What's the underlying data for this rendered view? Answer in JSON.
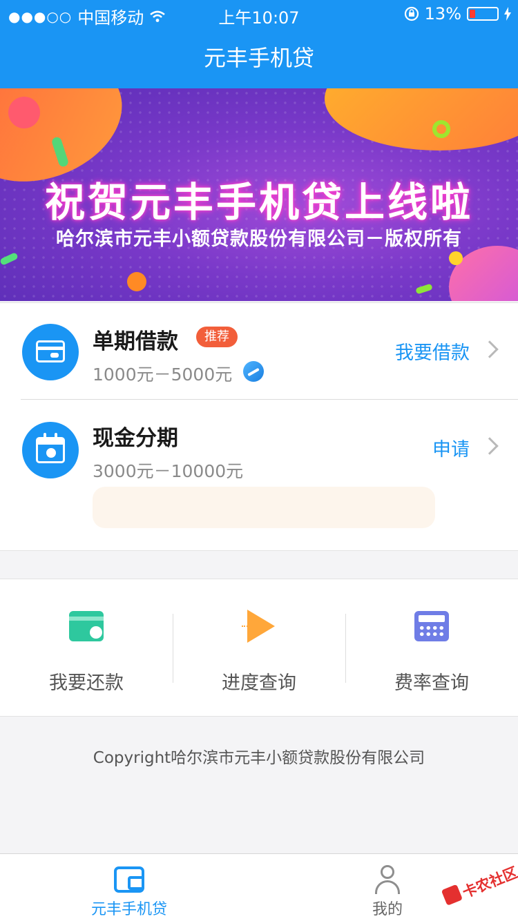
{
  "status_bar": {
    "signal": "●●●○○",
    "carrier": "中国移动",
    "time": "上午10:07",
    "battery_percent": "13%",
    "battery_level": 0.13
  },
  "nav": {
    "title": "元丰手机贷"
  },
  "banner": {
    "headline": "祝贺元丰手机贷上线啦",
    "subline": "哈尔滨市元丰小额贷款股份有限公司－版权所有"
  },
  "loans": [
    {
      "title": "单期借款",
      "tag": "推荐",
      "range": "1000元－5000元",
      "action": "我要借款",
      "icon": "card-icon"
    },
    {
      "title": "现金分期",
      "range": "3000元－10000元",
      "action": "申请",
      "icon": "calendar-icon"
    }
  ],
  "quick_actions": [
    {
      "label": "我要还款",
      "icon": "repay-card-icon",
      "color": "#2ec89e"
    },
    {
      "label": "进度查询",
      "icon": "paper-plane-icon",
      "color": "#ffa73a"
    },
    {
      "label": "费率查询",
      "icon": "calculator-icon",
      "color": "#6f7de6"
    }
  ],
  "footer": {
    "copyright": "Copyright哈尔滨市元丰小额贷款股份有限公司"
  },
  "tabbar": {
    "tabs": [
      {
        "label": "元丰手机贷",
        "icon": "wallet-icon",
        "active": true
      },
      {
        "label": "我的",
        "icon": "user-icon",
        "active": false
      }
    ]
  },
  "watermark": {
    "text": "卡农社区"
  },
  "colors": {
    "primary": "#1a95f4",
    "tag": "#f25e3a",
    "promo_bg": "#fdf5ec"
  }
}
